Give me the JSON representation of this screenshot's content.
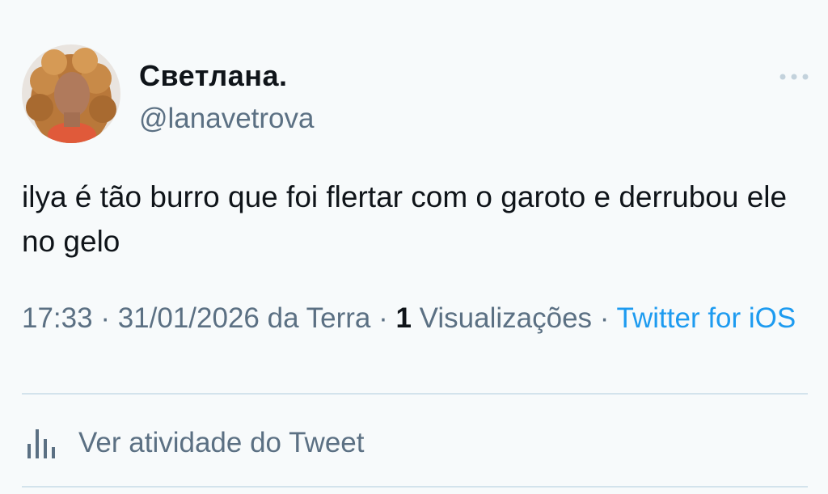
{
  "author": {
    "display_name": "Светлана.",
    "handle": "@lanavetrova",
    "avatar_icon": "profile-photo"
  },
  "more_icon": "more-dots-icon",
  "tweet": {
    "text": "ilya é tão burro que foi flertar com o garoto e derrubou ele no gelo"
  },
  "meta": {
    "time": "17:33",
    "sep1": " · ",
    "date": "31/01/2026 da Terra",
    "sep2": " · ",
    "views_count": "1",
    "views_label": " Visualizações",
    "sep3": " · ",
    "source": "Twitter for iOS"
  },
  "activity": {
    "icon": "analytics-icon",
    "label": "Ver atividade do Tweet"
  },
  "colors": {
    "background": "#f7fafb",
    "text": "#0f1419",
    "secondary": "#5b7083",
    "link": "#1d9bf0",
    "divider": "#d3e3ec"
  }
}
